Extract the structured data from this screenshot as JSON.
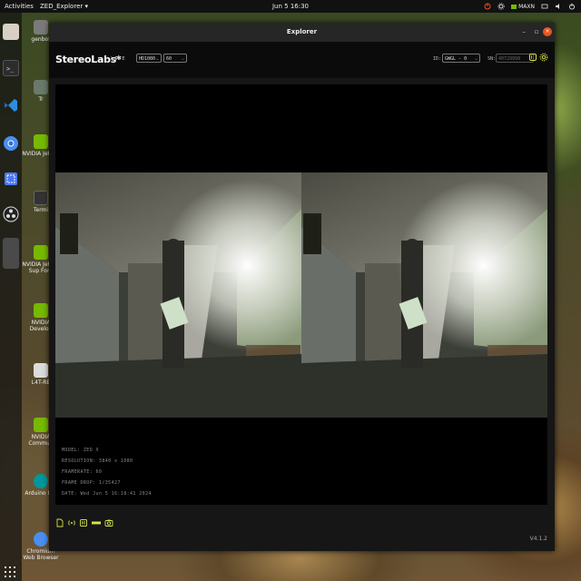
{
  "topbar": {
    "activities": "Activities",
    "app_menu": "ZED_Explorer ▾",
    "clock": "Jun 5  16:30",
    "nvidia_label": "MAXN"
  },
  "dock": {
    "items": [
      "files-icon",
      "terminal-icon",
      "vscode-icon",
      "chromium-icon",
      "screenshot-icon",
      "obs-icon",
      "zed-explorer-icon"
    ]
  },
  "desktop_icons": [
    {
      "label": "genbot",
      "icon": "home-folder-icon"
    },
    {
      "label": "Tr",
      "icon": "trash-icon"
    },
    {
      "label": "NVIDIA Jetson",
      "icon": "nvidia-icon"
    },
    {
      "label": "Termi",
      "icon": "terminal-icon"
    },
    {
      "label": "NVIDIA Jetson Sup Foru",
      "icon": "nvidia-icon"
    },
    {
      "label": "NVIDIA Develop",
      "icon": "nvidia-icon"
    },
    {
      "label": "L4T-RE",
      "icon": "document-icon"
    },
    {
      "label": "NVIDIA Commun",
      "icon": "nvidia-icon"
    },
    {
      "label": "Arduino IDE",
      "icon": "arduino-icon"
    },
    {
      "label": "Chromium Web Browser",
      "icon": "chromium-icon"
    }
  ],
  "window": {
    "title": "Explorer",
    "minimize": "–",
    "maximize": "▫",
    "close": "×"
  },
  "header": {
    "brand": "StereoLabs*",
    "live": "LIVE",
    "resolution_select": "HD1080",
    "fps_select": "60",
    "id_label": "ID:",
    "id_select": "GWGL - 0",
    "sn_label": "SN:",
    "sn_value": "40729998"
  },
  "info": {
    "model": "MODEL: ZED X",
    "resolution": "RESOLUTION: 3840 x 1080",
    "framerate": "FRAMERATE: 60",
    "frame_drop": "FRAME DROP: 1/35427",
    "date": "DATE: Wed Jun 5 16:18:41 2024"
  },
  "footer": {
    "version": "V4.1.2",
    "icons": [
      "record-icon",
      "stream-icon",
      "depth-icon",
      "rec-label-icon",
      "snapshot-icon"
    ]
  }
}
